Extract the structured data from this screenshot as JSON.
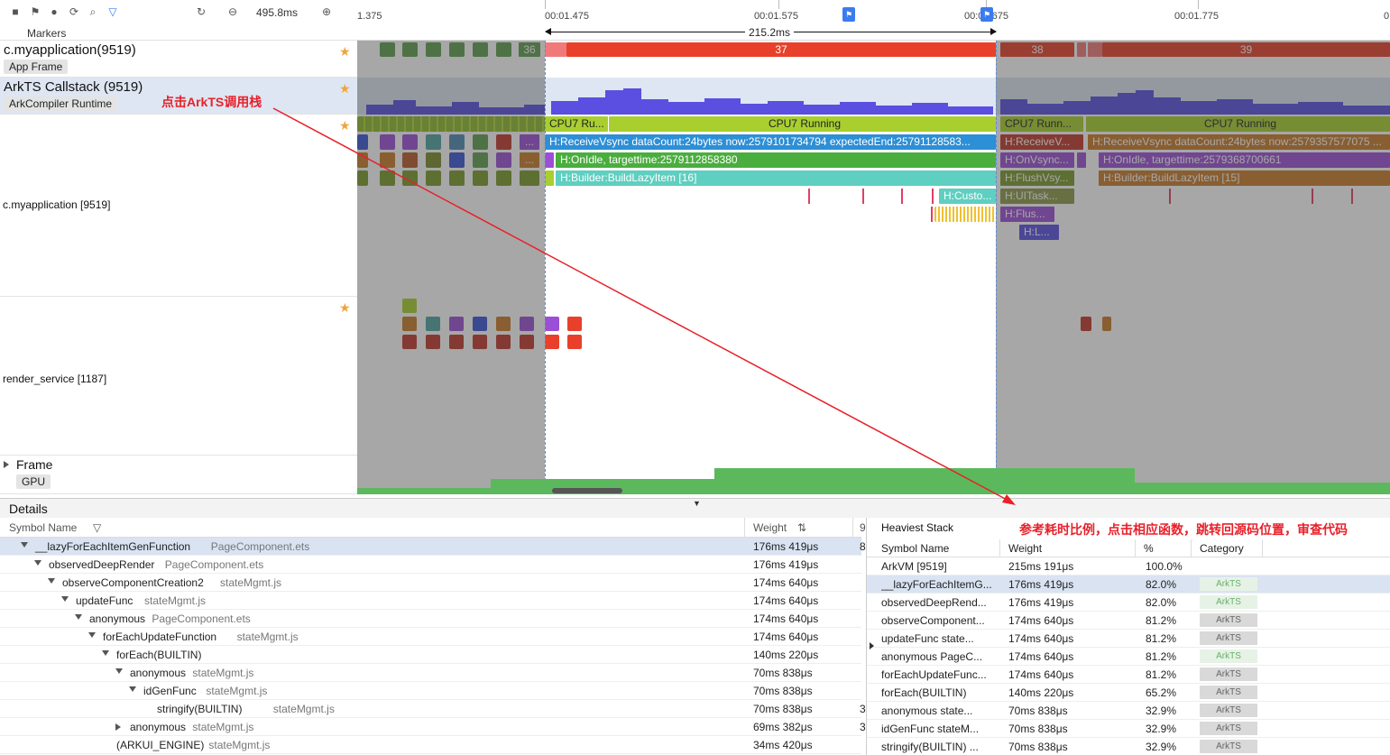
{
  "toolbar": {
    "icons": [
      "stop-icon",
      "flag-icon",
      "bookmark-icon",
      "capture-icon",
      "search-icon",
      "filter-icon",
      "reset-icon",
      "zoom-out-icon",
      "zoom-in-icon"
    ],
    "zoom_value": "495.8ms",
    "markers_label": "Markers"
  },
  "ruler": {
    "ticks": [
      "1.375",
      "00:01.475",
      "00:01.575",
      "00:01.675",
      "00:01.775",
      "0"
    ],
    "selection_duration": "215.2ms"
  },
  "rows": {
    "app_frame": {
      "title": "c.myapplication(9519)",
      "sub": "App Frame"
    },
    "arkts_callstack": {
      "title": "ArkTS Callstack (9519)",
      "sub": "ArkCompiler Runtime"
    },
    "main_thread": {
      "title": "c.myapplication [9519]"
    },
    "render_service": {
      "title": "render_service [1187]"
    },
    "frame": {
      "title": "Frame",
      "sub": "GPU"
    }
  },
  "frames": [
    {
      "label": "36"
    },
    {
      "label": "37"
    },
    {
      "label": "38"
    },
    {
      "label": "39"
    }
  ],
  "slices": {
    "cpu_running_short": "CPU7 Ru...",
    "cpu_running": "CPU7 Running",
    "cpu_running_short2": "CPU7 Runn...",
    "receive_vsync": "H:ReceiveVsync dataCount:24bytes now:2579101734794 expectedEnd:25791128583...",
    "onidle": "H:OnIdle, targettime:2579112858380",
    "build_lazy": "H:Builder:BuildLazyItem [16]",
    "custom": "H:Custo...",
    "receive_v_short": "H:ReceiveV...",
    "receive_vsync2": "H:ReceiveVsync dataCount:24bytes now:2579357577075 ...",
    "onvsync": "H:OnVsync...",
    "onidle2": "H:OnIdle, targettime:2579368700661",
    "flushvsy": "H:FlushVsy...",
    "build_lazy2": "H:Builder:BuildLazyItem [15]",
    "uitask": "H:UITask...",
    "flus": "H:Flus...",
    "hl": "H:L...",
    "ellipsis": "..."
  },
  "details": {
    "title": "Details",
    "columns": {
      "symbol": "Symbol Name",
      "weight": "Weight"
    },
    "tree": [
      {
        "name": "__lazyForEachItemGenFunction",
        "file": "PageComponent.ets",
        "weight": "176ms 419μs",
        "depth": 0,
        "expanded": true
      },
      {
        "name": "observedDeepRender",
        "file": "PageComponent.ets",
        "weight": "176ms 419μs",
        "depth": 1,
        "expanded": true
      },
      {
        "name": "observeComponentCreation2",
        "file": "stateMgmt.js",
        "weight": "174ms 640μs",
        "depth": 2,
        "expanded": true
      },
      {
        "name": "updateFunc",
        "file": "stateMgmt.js",
        "weight": "174ms 640μs",
        "depth": 3,
        "expanded": true
      },
      {
        "name": "anonymous",
        "file": "PageComponent.ets",
        "weight": "174ms 640μs",
        "depth": 4,
        "expanded": true
      },
      {
        "name": "forEachUpdateFunction",
        "file": "stateMgmt.js",
        "weight": "174ms 640μs",
        "depth": 5,
        "expanded": true
      },
      {
        "name": "forEach(BUILTIN)",
        "file": "",
        "weight": "140ms 220μs",
        "depth": 6,
        "expanded": true
      },
      {
        "name": "anonymous",
        "file": "stateMgmt.js",
        "weight": "70ms 838μs",
        "depth": 7,
        "expanded": true
      },
      {
        "name": "idGenFunc",
        "file": "stateMgmt.js",
        "weight": "70ms 838μs",
        "depth": 8,
        "expanded": true
      },
      {
        "name": "stringify(BUILTIN)",
        "file": "stateMgmt.js",
        "weight": "70ms 838μs",
        "depth": 9,
        "expanded": null
      },
      {
        "name": "anonymous",
        "file": "stateMgmt.js",
        "weight": "69ms 382μs",
        "depth": 7,
        "expanded": false
      },
      {
        "name": "(ARKUI_ENGINE)",
        "file": "stateMgmt.js",
        "weight": "34ms 420μs",
        "depth": 6,
        "expanded": null
      }
    ],
    "side_values": [
      "9",
      "8",
      "3",
      "3"
    ]
  },
  "heaviest": {
    "title": "Heaviest Stack",
    "columns": {
      "symbol": "Symbol Name",
      "weight": "Weight",
      "percent": "%",
      "category": "Category"
    },
    "rows": [
      {
        "name": "ArkVM [9519]",
        "weight": "215ms 191μs",
        "percent": "100.0%",
        "category": ""
      },
      {
        "name": "__lazyForEachItemG...",
        "weight": "176ms 419μs",
        "percent": "82.0%",
        "category": "ArkTS"
      },
      {
        "name": "observedDeepRend...",
        "weight": "176ms 419μs",
        "percent": "82.0%",
        "category": "ArkTS"
      },
      {
        "name": "observeComponent...",
        "weight": "174ms 640μs",
        "percent": "81.2%",
        "category": "ArkTS"
      },
      {
        "name": "updateFunc   state...",
        "weight": "174ms 640μs",
        "percent": "81.2%",
        "category": "ArkTS"
      },
      {
        "name": "anonymous   PageC...",
        "weight": "174ms 640μs",
        "percent": "81.2%",
        "category": "ArkTS"
      },
      {
        "name": "forEachUpdateFunc...",
        "weight": "174ms 640μs",
        "percent": "81.2%",
        "category": "ArkTS"
      },
      {
        "name": "forEach(BUILTIN)",
        "weight": "140ms 220μs",
        "percent": "65.2%",
        "category": "ArkTS"
      },
      {
        "name": "anonymous   state...",
        "weight": "70ms 838μs",
        "percent": "32.9%",
        "category": "ArkTS"
      },
      {
        "name": "idGenFunc   stateM...",
        "weight": "70ms 838μs",
        "percent": "32.9%",
        "category": "ArkTS"
      },
      {
        "name": "stringify(BUILTIN) ...",
        "weight": "70ms 838μs",
        "percent": "32.9%",
        "category": "ArkTS"
      }
    ]
  },
  "annotations": {
    "click_callstack": "点击ArkTS调用栈",
    "hint": "参考耗时比例，点击相应函数，跳转回源码位置，审查代码"
  },
  "colors": {
    "frame_green": "#5d9e4f",
    "frame_red": "#e8402a",
    "selection_blue": "#5b8fd6",
    "annotation_red": "#e8202a",
    "callstack_purple": "#5a4fe0"
  }
}
